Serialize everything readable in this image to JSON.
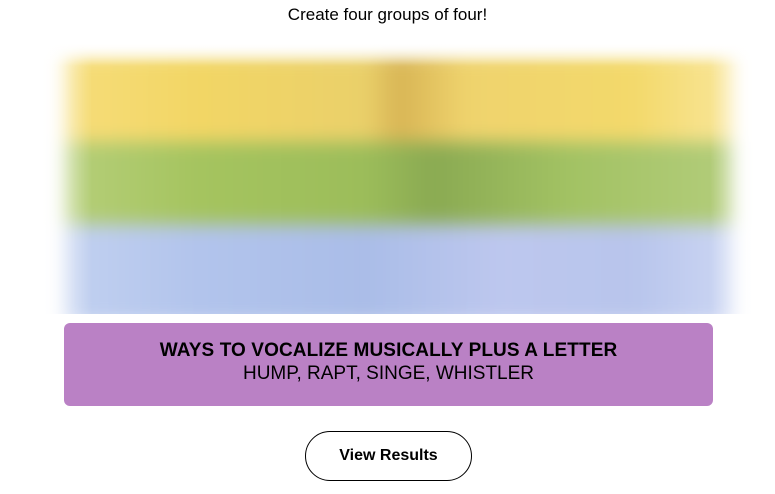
{
  "instructions": "Create four groups of four!",
  "board": {
    "colors": {
      "yellow": "#f3d96b",
      "green": "#a0c35a",
      "blue": "#b0c4ef",
      "purple": "#ba81c5"
    }
  },
  "solved_group": {
    "title": "WAYS TO VOCALIZE MUSICALLY PLUS A LETTER",
    "members": "HUMP, RAPT, SINGE, WHISTLER",
    "color": "#ba81c5"
  },
  "results_button": {
    "label": "View Results"
  }
}
